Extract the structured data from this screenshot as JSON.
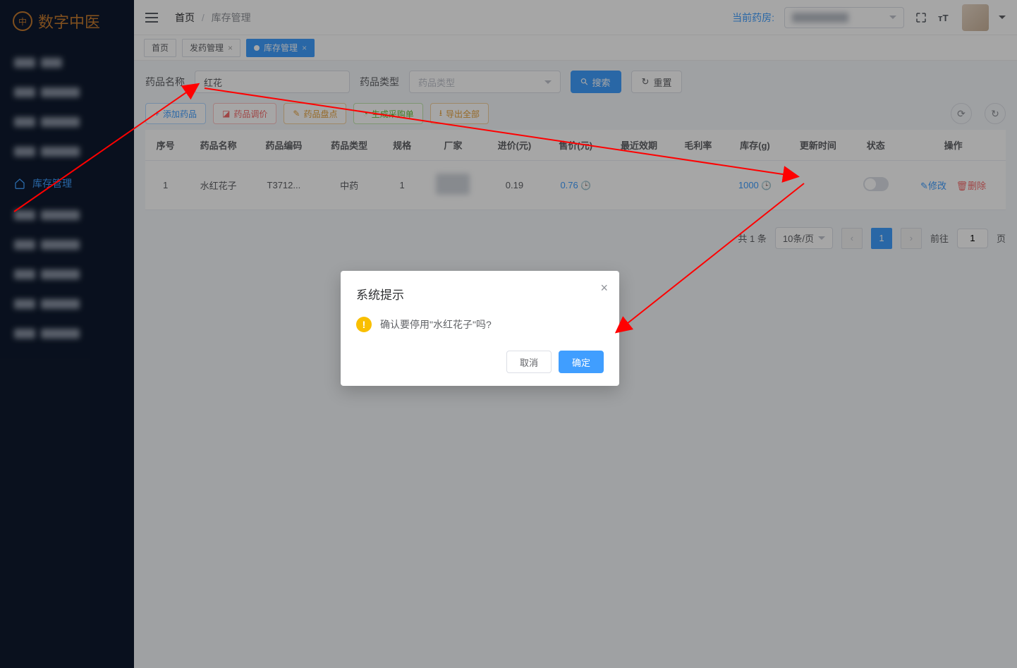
{
  "brand": "数字中医",
  "sidebar": {
    "items": [
      {
        "label": "▇▇",
        "active": false
      },
      {
        "label": "▇▇",
        "active": false
      },
      {
        "label": "▇▇",
        "active": false
      },
      {
        "label": "▇▇",
        "active": false
      },
      {
        "label": "库存管理",
        "active": true
      },
      {
        "label": "▇▇",
        "active": false
      },
      {
        "label": "▇▇",
        "active": false
      },
      {
        "label": "▇▇",
        "active": false
      },
      {
        "label": "▇▇",
        "active": false
      },
      {
        "label": "▇▇",
        "active": false
      }
    ]
  },
  "breadcrumb": {
    "home": "首页",
    "current": "库存管理"
  },
  "header": {
    "pharmacy_label": "当前药房:"
  },
  "tabs": [
    {
      "label": "首页",
      "active": false,
      "closable": false
    },
    {
      "label": "发药管理",
      "active": false,
      "closable": true
    },
    {
      "label": "库存管理",
      "active": true,
      "closable": true
    }
  ],
  "filters": {
    "name_label": "药品名称",
    "name_value": "红花",
    "type_label": "药品类型",
    "type_placeholder": "药品类型",
    "search_btn": "搜索",
    "reset_btn": "重置"
  },
  "actions": {
    "add": "添加药品",
    "adjust": "药品调价",
    "check": "药品盘点",
    "purchase": "生成采购单",
    "export": "导出全部"
  },
  "table": {
    "headers": [
      "序号",
      "药品名称",
      "药品编码",
      "药品类型",
      "规格",
      "厂家",
      "进价(元)",
      "售价(元)",
      "最近效期",
      "毛利率",
      "库存(g)",
      "更新时间",
      "状态",
      "操作"
    ],
    "row": {
      "index": "1",
      "name": "水红花子",
      "code": "T3712...",
      "type": "中药",
      "spec": "1",
      "cost": "0.19",
      "price": "0.76",
      "stock": "1000",
      "op_edit": "修改",
      "op_del": "删除"
    }
  },
  "pagination": {
    "total_label": "共 1 条",
    "per_page": "10条/页",
    "current": "1",
    "goto_label": "前往",
    "goto_value": "1",
    "page_suffix": "页"
  },
  "dialog": {
    "title": "系统提示",
    "message": "确认要停用\"水红花子\"吗?",
    "cancel": "取消",
    "confirm": "确定"
  }
}
